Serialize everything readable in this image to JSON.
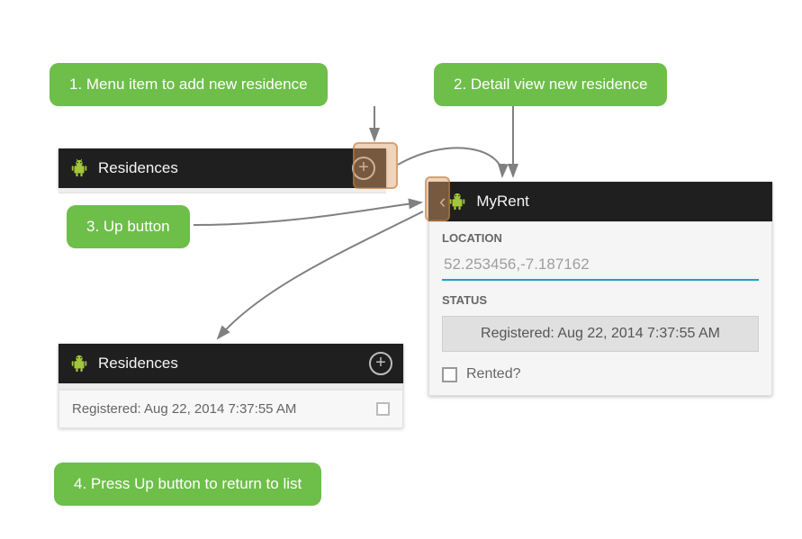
{
  "callouts": {
    "c1": "1. Menu item to add new residence",
    "c2": "2. Detail view new residence",
    "c3": "3. Up button",
    "c4": "4. Press Up button to return to list"
  },
  "screen1": {
    "title": "Residences"
  },
  "screen2": {
    "title": "MyRent",
    "location_label": "LOCATION",
    "location_value": "52.253456,-7.187162",
    "status_label": "STATUS",
    "status_button": "Registered: Aug 22, 2014 7:37:55 AM",
    "rented_label": "Rented?"
  },
  "screen3": {
    "title": "Residences",
    "row_text": "Registered: Aug 22, 2014 7:37:55 AM"
  }
}
